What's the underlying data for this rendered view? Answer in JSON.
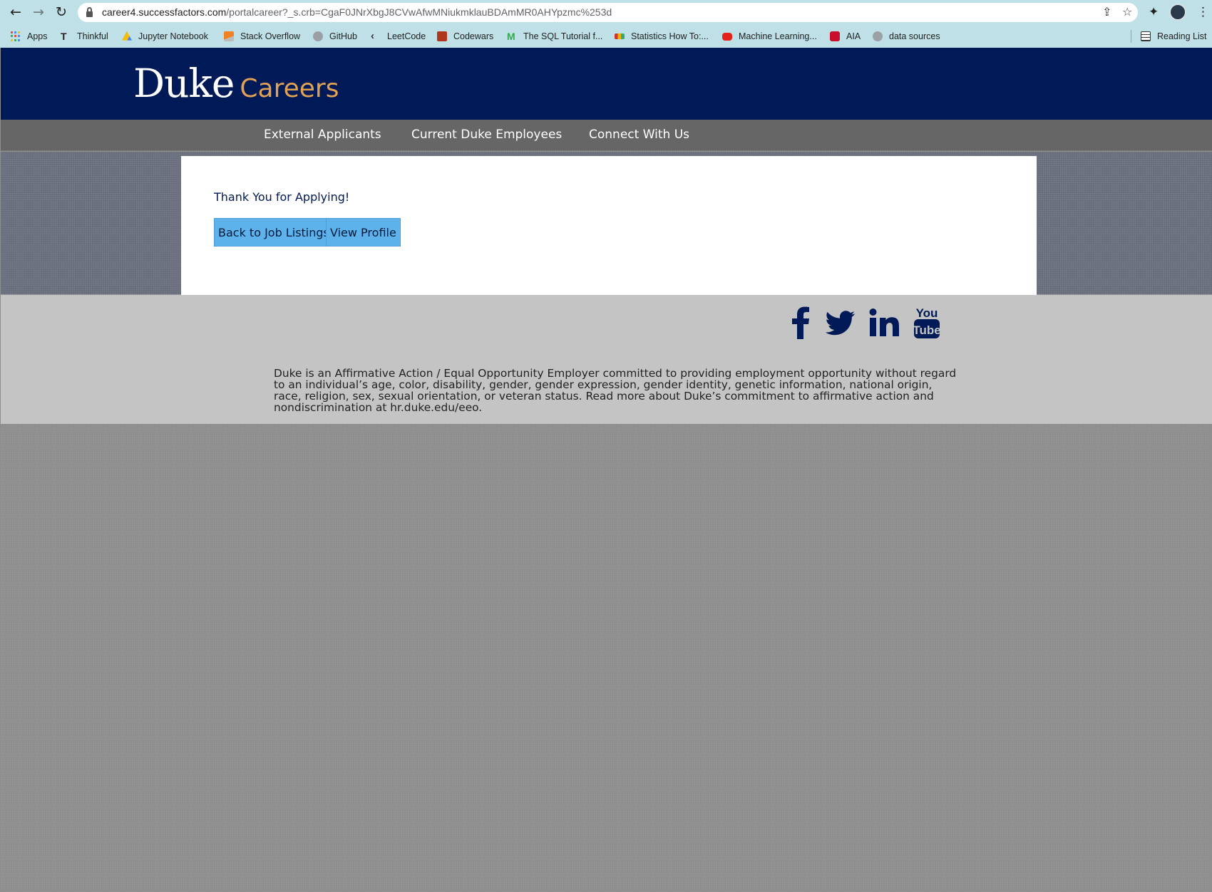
{
  "browser": {
    "url_domain": "career4.successfactors.com",
    "url_path": "/portalcareer?_s.crb=CgaF0JNrXbgJ8CVwAfwMNiukmklauBDAmMR0AHYpzmc%253d",
    "bookmarks": [
      {
        "label": "Apps",
        "icon": "apps-grid-icon"
      },
      {
        "label": "Thinkful",
        "icon": "thinkful-icon"
      },
      {
        "label": "Jupyter Notebook",
        "icon": "google-drive-icon"
      },
      {
        "label": "Stack Overflow",
        "icon": "stackoverflow-icon"
      },
      {
        "label": "GitHub",
        "icon": "github-icon"
      },
      {
        "label": "LeetCode",
        "icon": "leetcode-icon"
      },
      {
        "label": "Codewars",
        "icon": "codewars-icon"
      },
      {
        "label": "The SQL Tutorial f...",
        "icon": "sql-tutorial-icon"
      },
      {
        "label": "Statistics How To:...",
        "icon": "statistics-icon"
      },
      {
        "label": "Machine Learning...",
        "icon": "youtube-icon"
      },
      {
        "label": "AIA",
        "icon": "aia-icon"
      },
      {
        "label": "data sources",
        "icon": "github-icon"
      }
    ],
    "reading_list": "Reading List"
  },
  "site": {
    "logo_main": "Duke",
    "logo_sub": "Careers",
    "nav": [
      "External Applicants",
      "Current Duke Employees",
      "Connect With Us"
    ]
  },
  "main": {
    "message": "Thank You for Applying!",
    "back_button": "Back to Job Listings",
    "profile_button": "View Profile"
  },
  "footer": {
    "social": [
      "facebook",
      "twitter",
      "linkedin",
      "youtube"
    ],
    "youtube_top": "You",
    "youtube_bottom": "Tube",
    "eeo_text": "Duke is an Affirmative Action / Equal Opportunity Employer committed to providing employment opportunity without regard to an individual’s age, color, disability, gender, gender expression, gender identity, genetic information, national origin, race, religion, sex, sexual orientation, or veteran status. Read more about Duke’s commitment to affirmative action and nondiscrimination at hr.duke.edu/eeo."
  },
  "colors": {
    "duke_navy": "#001a57",
    "careers_gold": "#e1a155",
    "button_blue": "#5eb2ec",
    "nav_gray": "#666666"
  }
}
